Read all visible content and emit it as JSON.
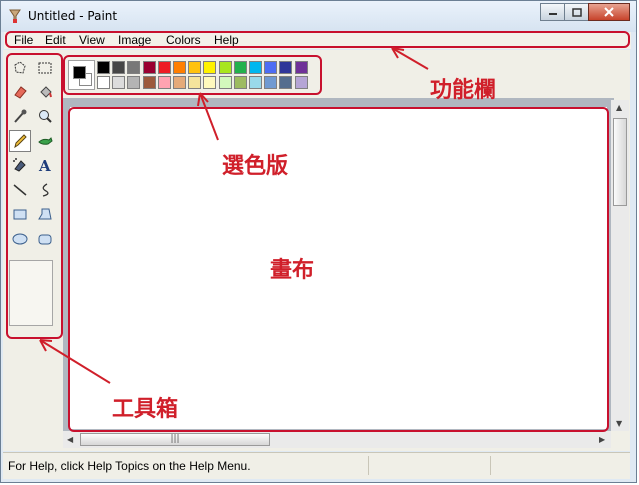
{
  "window": {
    "title": "Untitled - Paint",
    "controls": [
      "minimize",
      "maximize",
      "close"
    ]
  },
  "menubar": {
    "items": [
      "File",
      "Edit",
      "View",
      "Image",
      "Colors",
      "Help"
    ]
  },
  "toolbox": {
    "tools": [
      {
        "name": "free-form-select-icon"
      },
      {
        "name": "select-icon"
      },
      {
        "name": "eraser-icon"
      },
      {
        "name": "fill-bucket-icon"
      },
      {
        "name": "pick-color-icon"
      },
      {
        "name": "magnifier-icon"
      },
      {
        "name": "pencil-icon",
        "active": true
      },
      {
        "name": "brush-icon"
      },
      {
        "name": "airbrush-icon"
      },
      {
        "name": "text-icon"
      },
      {
        "name": "line-icon"
      },
      {
        "name": "curve-icon"
      },
      {
        "name": "rectangle-icon"
      },
      {
        "name": "polygon-icon"
      },
      {
        "name": "ellipse-icon"
      },
      {
        "name": "rounded-rectangle-icon"
      }
    ]
  },
  "palette": {
    "foreground": "#000000",
    "background": "#ffffff",
    "row1": [
      "#000000",
      "#464646",
      "#787878",
      "#990030",
      "#ed1c24",
      "#ff7e00",
      "#ffc20e",
      "#fff200",
      "#a8e61d",
      "#22b14c",
      "#00b7ef",
      "#4d6df3",
      "#2f3699",
      "#6f3198"
    ],
    "row2": [
      "#ffffff",
      "#dcdcdc",
      "#b4b4b4",
      "#9c5a3c",
      "#ffa3b1",
      "#e5aa7a",
      "#f5e49c",
      "#fff9bd",
      "#d3f9bc",
      "#9dbb61",
      "#99d9ea",
      "#709ad1",
      "#546d8e",
      "#b5a5d5"
    ]
  },
  "statusbar": {
    "help_text": "For Help, click Help Topics on the Help Menu."
  },
  "annotations": {
    "menu_label": "功能欄",
    "palette_label": "選色版",
    "canvas_label": "畫布",
    "toolbox_label": "工具箱",
    "color": "#d01f2a"
  }
}
